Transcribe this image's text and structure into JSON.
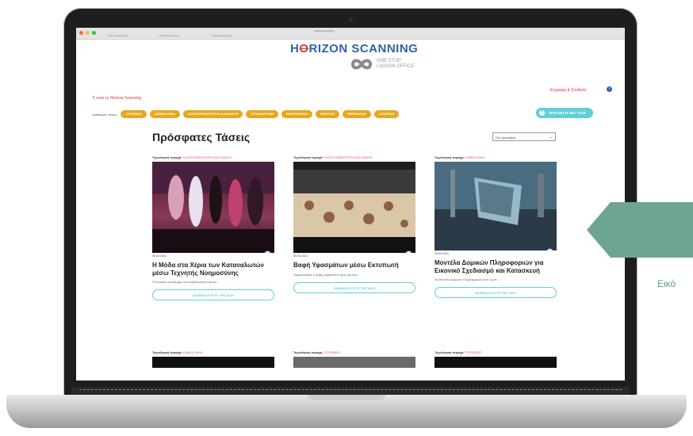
{
  "browser": {
    "tabs": [
      "horizonscanning.gr",
      "horizonscanning.gr",
      "horizonscanning.gr"
    ],
    "url": "horizonscanning.gr"
  },
  "site": {
    "logo_a": "H",
    "logo_strike": "O",
    "logo_b": "RIZON SCANNING",
    "subbrand_line1": "ONE STOP",
    "subbrand_line2": "LIAISON OFFICE",
    "about_link": "Τι είναι το Horizon Scanning",
    "login_link": "Εγγραφή & Σύνδεση",
    "filter_label": "Διαθέσιμες τάσεις:",
    "filters": [
      "ΤΟΥΡΙΣΜΟΣ",
      "ΔΟΜΙΚΑ ΥΛΙΚΑ",
      "ΚΛΩΣΤΟΫΦΑΝΤΟΥΡΓΙΑ ΚΑΙ ΕΝΔΥΣΗ",
      "ΑΓΡΟΔΙΑΤΡΟΦΗ",
      "ΠΛΗΡΟΦΟΡΙΚΗ",
      "ΕΝΕΡΓΕΙΑ",
      "ΠΕΡΙΒΑΛΛΟΝ",
      "LOGISTICS"
    ],
    "add_trend": "ΠΡΟΣΘΕΣΤΕ ΜΙΑ ΤΑΣΗ",
    "page_title": "Πρόσφατες Τάσεις",
    "sort_value": "Πιο πρόσφατο"
  },
  "cards": [
    {
      "cat_label": "Τεχνολογική περιοχή:",
      "cat_value": "ΚΛΩΣΤΟΫΦΑΝΤΟΥΡΓΙΑ ΚΑΙ ΕΝΔΥΣΗ",
      "date": "05.03.2021",
      "title": "Η Μόδα στα Χέρια των Καταναλωτών μέσω Τεχνητής Νοημοσύνης",
      "excerpt": "Ένα ακόμα πρόβλημα του παραδοσιακού τρόπο...",
      "rate": "ΒΑΘΜΟΛΟΓΗΣΤΕ ΤΗΝ ΤΑΣΗ"
    },
    {
      "cat_label": "Τεχνολογική περιοχή:",
      "cat_value": "ΚΛΩΣΤΟΫΦΑΝΤΟΥΡΓΙΑ ΚΑΙ ΕΝΔΥΣΗ",
      "date": "05.03.2021",
      "title": "Βαφή Υφασμάτων μέσω Εκτυπωτή",
      "excerpt": "Παραδοσιακά, η βαφή υφασμάτων ήταν μια περ...",
      "rate": "ΒΑΘΜΟΛΟΓΗΣΤΕ ΤΗΝ ΤΑΣΗ"
    },
    {
      "cat_label": "Τεχνολογική περιοχή:",
      "cat_value": "ΔΟΜΙΚΑ ΥΛΙΚΑ",
      "date": "05.03.2021",
      "title": "Μοντέλα Δομικών Πληροφοριών για Εικονικό Σχεδιασμό και Κατασκευή",
      "excerpt": "Τα Μοντέλα Δομικών Πληροφοριών είναι η μεθ...",
      "rate": "ΒΑΘΜΟΛΟΓΗΣΤΕ ΤΗΝ ΤΑΣΗ"
    }
  ],
  "cards_row2": [
    {
      "cat_label": "Τεχνολογική περιοχή:",
      "cat_value": "ΔΟΜΙΚΑ ΥΛΙΚΑ"
    },
    {
      "cat_label": "Τεχνολογική περιοχή:",
      "cat_value": "ΤΟΥΡΙΣΜΟΣ"
    },
    {
      "cat_label": "Τεχνολογική περιοχή:",
      "cat_value": "ΤΟΥΡΙΣΜΟΣ"
    }
  ],
  "decoration": {
    "caption": "Εικό"
  },
  "colors": {
    "brand_blue": "#2f62a8",
    "accent_red": "#e8483f",
    "pill_gold": "#e6a81d",
    "teal": "#5ecfd6",
    "deco_green": "#6ea592"
  }
}
